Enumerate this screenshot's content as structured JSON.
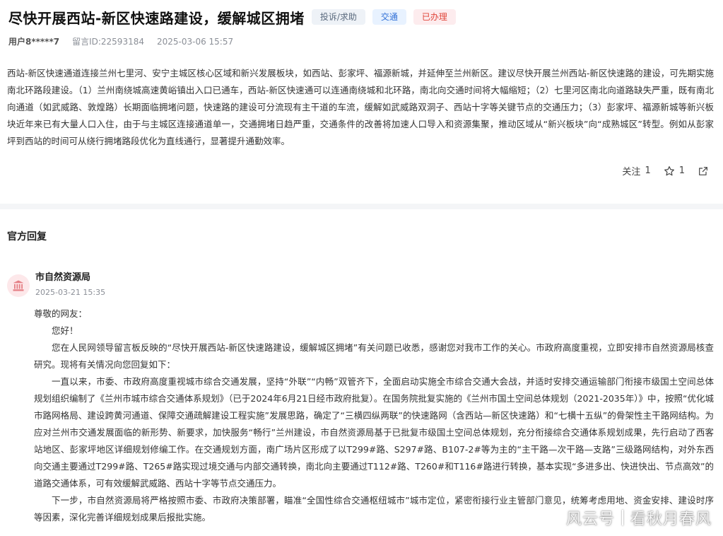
{
  "header": {
    "title": "尽快开展西站-新区快速路建设，缓解城区拥堵",
    "tags": [
      "投诉/求助",
      "交通",
      "已办理"
    ]
  },
  "meta": {
    "user": "用户8*****7",
    "message_id": "留言ID:22593184",
    "datetime": "2025-03-06 15:57"
  },
  "body": "西站-新区快速通道连接兰州七里河、安宁主城区核心区域和新兴发展板块，如西站、彭家坪、福源新城，并延伸至兰州新区。建议尽快开展兰州西站-新区快速路的建设，可先期实施南北环路段建设。（1）兰州南绕城高速黄峪镇出入口已通车，西站-新区快速通可以连通南绕城和北环路，南北向交通时间将大幅缩短；（2）七里河区南北向道路缺失严重，既有南北向通道（如武威路、敦煌路）长期面临拥堵问题，快速路的建设可分流现有主干道的车流，缓解如武威路双洞子、西站十字等关键节点的交通压力；（3）彭家坪、福源新城等新兴板块近年来已有大量人口入住，由于与主城区连接通道单一，交通拥堵日趋严重，交通条件的改善将加速人口导入和资源集聚，推动区域从“新兴板块”向“成熟城区”转型。例如从彭家坪到西站的时间可从绕行拥堵路段优化为直线通行，显著提升通勤效率。",
  "actions": {
    "follow_label": "关注",
    "follow_count": "1",
    "star_count": "1"
  },
  "reply_section": {
    "title": "官方回复",
    "org": "市自然资源局",
    "date": "2025-03-21 15:35",
    "salutation": "尊敬的网友：",
    "greeting": "您好！",
    "paragraphs": [
      "您在人民网领导留言板反映的“尽快开展西站-新区快速路建设，缓解城区拥堵”有关问题已收悉，感谢您对我市工作的关心。市政府高度重视，立即安排市自然资源局核查研究。现将有关情况向您回复如下：",
      "一直以来，市委、市政府高度重视城市综合交通发展，坚持“外联”“内畅”双管齐下，全面启动实施全市综合交通大会战，并适时安排交通运输部门衔接市级国土空间总体规划组织编制了《兰州市城市综合交通体系规划》（已于2024年6月21日经市政府批复）。在国务院批复实施的《兰州市国土空间总体规划（2021-2035年）》中，按照“优化城市路网格局、建设跨黄河通道、保障交通疏解建设工程实施”发展思路，确定了“三横四纵两联”的快速路网（含西站—新区快速路）和“七横十五纵”的骨架性主干路网结构。为应对兰州市交通发展面临的新形势、新要求，加快服务“畅行”兰州建设，市自然资源局基于已批复市级国土空间总体规划，充分衔接综合交通体系规划成果，先行启动了西客站地区、彭家坪地区详细规划修编工作。在交通规划方面，南广场片区形成了以T299#路、S297#路、B107-2#等为主的“主干路—次干路—支路”三级路网结构，对外东西向交通主要通过T299#路、T265#路实现过境交通与内部交通转换，南北向主要通过T112#路、T260#和T116#路进行转换，基本实现“多进多出、快进快出、节点高效”的道路交通体系，可有效缓解武威路、西站十字等节点交通压力。",
      "下一步，市自然资源局将严格按照市委、市政府决策部署，瞄准“全国性综合交通枢纽城市”城市定位，紧密衔接行业主管部门意见，统筹考虑用地、资金安排、建设时序等因素，深化完善详细规划成果后报批实施。"
    ]
  },
  "watermark": {
    "platform": "风云号",
    "author": "看秋月春风"
  }
}
